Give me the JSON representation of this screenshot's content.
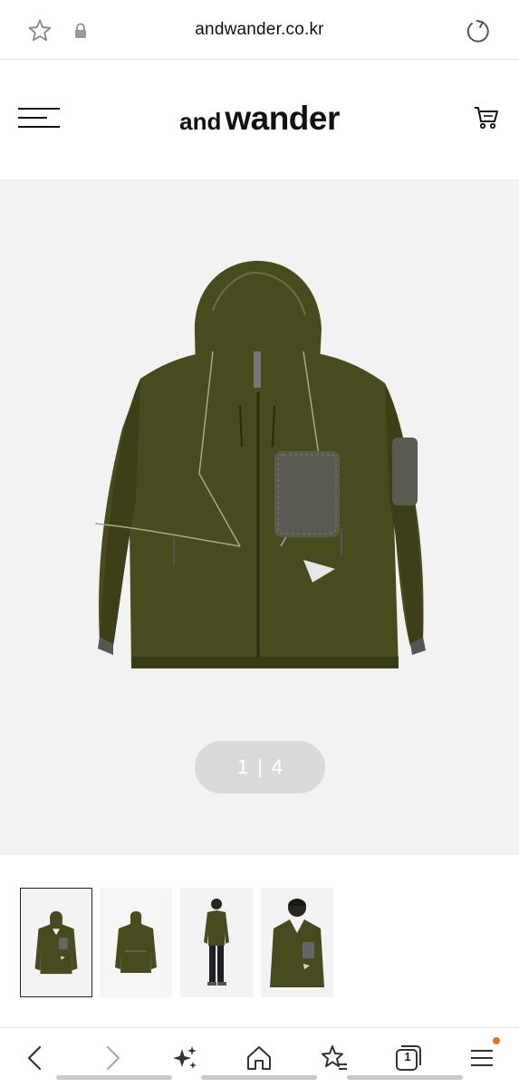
{
  "browser": {
    "url": "andwander.co.kr"
  },
  "site": {
    "logo_and": "and",
    "logo_wander": "wander"
  },
  "product": {
    "image_index": "1",
    "image_separator": "|",
    "image_total": "4",
    "jacket_color": "#4a4a1f"
  },
  "thumbnails": [
    {
      "alt": "jacket front",
      "selected": true
    },
    {
      "alt": "jacket back",
      "selected": false
    },
    {
      "alt": "model full body",
      "selected": false
    },
    {
      "alt": "model upper body",
      "selected": false
    }
  ],
  "bottom_nav": {
    "tabs_count": "1",
    "items": [
      "back-icon",
      "forward-icon",
      "sparkle-icon",
      "home-icon",
      "favorites-icon",
      "tabs-icon",
      "menu-icon"
    ]
  },
  "colors": {
    "accent_dot": "#f06a1e",
    "hero_bg": "#f2f2f2"
  }
}
